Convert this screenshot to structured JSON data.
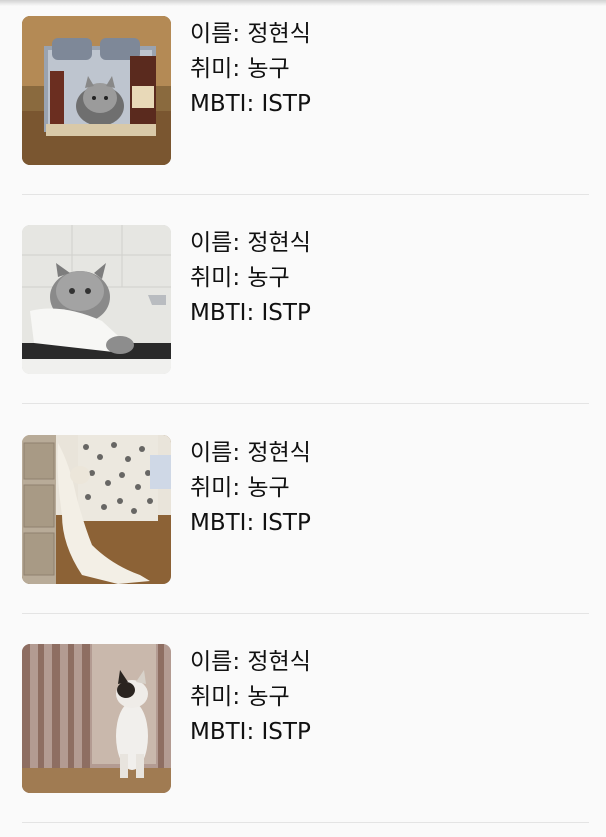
{
  "list": {
    "items": [
      {
        "name_label": "이름: 정현식",
        "hobby_label": "취미: 농구",
        "mbti_label": "MBTI: ISTP",
        "photo": "cat-in-plastic-crate"
      },
      {
        "name_label": "이름: 정현식",
        "hobby_label": "취미: 농구",
        "mbti_label": "MBTI: ISTP",
        "photo": "wet-cat-in-towel"
      },
      {
        "name_label": "이름: 정현식",
        "hobby_label": "취미: 농구",
        "mbti_label": "MBTI: ISTP",
        "photo": "white-cat-climbing-drawers"
      },
      {
        "name_label": "이름: 정현식",
        "hobby_label": "취미: 농구",
        "mbti_label": "MBTI: ISTP",
        "photo": "cat-standing-at-curtain"
      }
    ]
  }
}
